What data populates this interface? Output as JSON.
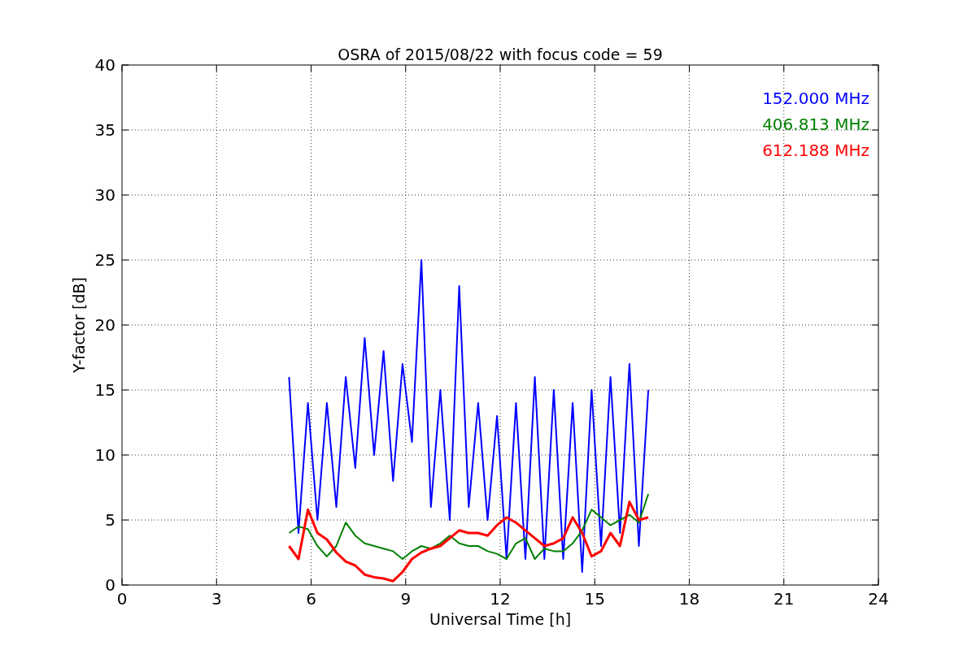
{
  "figure": {
    "chart_data": {
      "type": "line",
      "title": "OSRA of 2015/08/22 with focus code = 59",
      "xlabel": "Universal Time [h]",
      "ylabel": "Y-factor [dB]",
      "x": [
        5.3,
        5.6,
        5.9,
        6.2,
        6.5,
        6.8,
        7.1,
        7.4,
        7.7,
        8.0,
        8.3,
        8.6,
        8.9,
        9.2,
        9.5,
        9.8,
        10.1,
        10.4,
        10.7,
        11.0,
        11.3,
        11.6,
        11.9,
        12.2,
        12.5,
        12.8,
        13.1,
        13.4,
        13.7,
        14.0,
        14.3,
        14.6,
        14.9,
        15.2,
        15.5,
        15.8,
        16.1,
        16.4,
        16.7
      ],
      "series": [
        {
          "name": "152.000 MHz",
          "color": "#0000ff",
          "values": [
            16,
            4,
            14,
            5,
            14,
            6,
            16,
            9,
            19,
            10,
            18,
            8,
            17,
            11,
            25,
            6,
            15,
            5,
            23,
            6,
            14,
            5,
            13,
            2,
            14,
            2,
            16,
            2,
            15,
            2,
            14,
            1,
            15,
            3,
            16,
            4,
            17,
            3,
            15
          ]
        },
        {
          "name": "406.813 MHz",
          "color": "#008000",
          "values": [
            4,
            4.5,
            4.3,
            3.0,
            2.2,
            3.0,
            4.8,
            3.8,
            3.2,
            3.0,
            2.8,
            2.6,
            2.0,
            2.6,
            3.0,
            2.8,
            3.2,
            3.8,
            3.2,
            3.0,
            3.0,
            2.6,
            2.4,
            2.0,
            3.2,
            3.6,
            2.0,
            2.8,
            2.6,
            2.6,
            3.2,
            4.2,
            5.8,
            5.2,
            4.6,
            5.0,
            5.4,
            4.8,
            7.0
          ]
        },
        {
          "name": "612.188 MHz",
          "color": "#ff0000",
          "values": [
            3,
            2.0,
            5.8,
            4.0,
            3.5,
            2.5,
            1.8,
            1.5,
            0.8,
            0.6,
            0.5,
            0.3,
            1.0,
            2.0,
            2.5,
            2.8,
            3.0,
            3.6,
            4.2,
            4.0,
            4.0,
            3.8,
            4.6,
            5.2,
            4.8,
            4.2,
            3.6,
            3.0,
            3.2,
            3.6,
            5.2,
            4.0,
            2.2,
            2.6,
            4.0,
            3.0,
            6.4,
            5.0,
            5.2
          ]
        }
      ],
      "xlim": [
        0,
        24
      ],
      "ylim": [
        0,
        40
      ],
      "xticks": [
        0,
        3,
        6,
        9,
        12,
        15,
        18,
        21,
        24
      ],
      "yticks": [
        0,
        5,
        10,
        15,
        20,
        25,
        30,
        35,
        40
      ],
      "grid": true
    }
  }
}
